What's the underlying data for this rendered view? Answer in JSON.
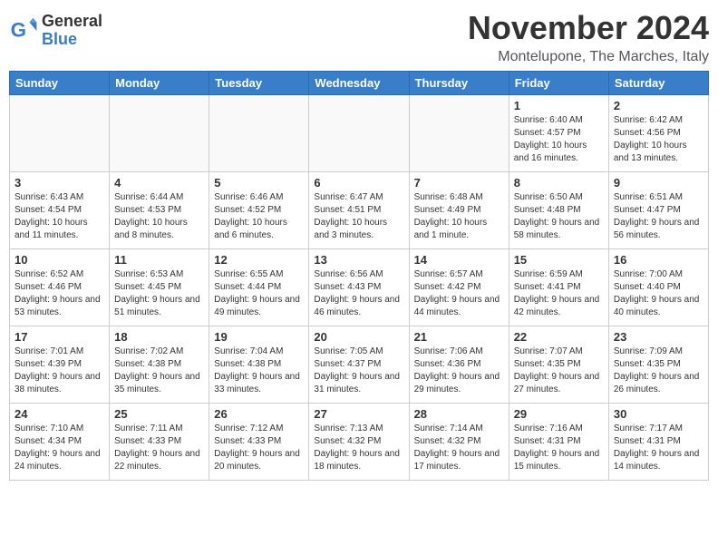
{
  "logo": {
    "general": "General",
    "blue": "Blue"
  },
  "title": "November 2024",
  "location": "Montelupone, The Marches, Italy",
  "days_of_week": [
    "Sunday",
    "Monday",
    "Tuesday",
    "Wednesday",
    "Thursday",
    "Friday",
    "Saturday"
  ],
  "weeks": [
    [
      {
        "day": "",
        "info": ""
      },
      {
        "day": "",
        "info": ""
      },
      {
        "day": "",
        "info": ""
      },
      {
        "day": "",
        "info": ""
      },
      {
        "day": "",
        "info": ""
      },
      {
        "day": "1",
        "info": "Sunrise: 6:40 AM\nSunset: 4:57 PM\nDaylight: 10 hours and 16 minutes."
      },
      {
        "day": "2",
        "info": "Sunrise: 6:42 AM\nSunset: 4:56 PM\nDaylight: 10 hours and 13 minutes."
      }
    ],
    [
      {
        "day": "3",
        "info": "Sunrise: 6:43 AM\nSunset: 4:54 PM\nDaylight: 10 hours and 11 minutes."
      },
      {
        "day": "4",
        "info": "Sunrise: 6:44 AM\nSunset: 4:53 PM\nDaylight: 10 hours and 8 minutes."
      },
      {
        "day": "5",
        "info": "Sunrise: 6:46 AM\nSunset: 4:52 PM\nDaylight: 10 hours and 6 minutes."
      },
      {
        "day": "6",
        "info": "Sunrise: 6:47 AM\nSunset: 4:51 PM\nDaylight: 10 hours and 3 minutes."
      },
      {
        "day": "7",
        "info": "Sunrise: 6:48 AM\nSunset: 4:49 PM\nDaylight: 10 hours and 1 minute."
      },
      {
        "day": "8",
        "info": "Sunrise: 6:50 AM\nSunset: 4:48 PM\nDaylight: 9 hours and 58 minutes."
      },
      {
        "day": "9",
        "info": "Sunrise: 6:51 AM\nSunset: 4:47 PM\nDaylight: 9 hours and 56 minutes."
      }
    ],
    [
      {
        "day": "10",
        "info": "Sunrise: 6:52 AM\nSunset: 4:46 PM\nDaylight: 9 hours and 53 minutes."
      },
      {
        "day": "11",
        "info": "Sunrise: 6:53 AM\nSunset: 4:45 PM\nDaylight: 9 hours and 51 minutes."
      },
      {
        "day": "12",
        "info": "Sunrise: 6:55 AM\nSunset: 4:44 PM\nDaylight: 9 hours and 49 minutes."
      },
      {
        "day": "13",
        "info": "Sunrise: 6:56 AM\nSunset: 4:43 PM\nDaylight: 9 hours and 46 minutes."
      },
      {
        "day": "14",
        "info": "Sunrise: 6:57 AM\nSunset: 4:42 PM\nDaylight: 9 hours and 44 minutes."
      },
      {
        "day": "15",
        "info": "Sunrise: 6:59 AM\nSunset: 4:41 PM\nDaylight: 9 hours and 42 minutes."
      },
      {
        "day": "16",
        "info": "Sunrise: 7:00 AM\nSunset: 4:40 PM\nDaylight: 9 hours and 40 minutes."
      }
    ],
    [
      {
        "day": "17",
        "info": "Sunrise: 7:01 AM\nSunset: 4:39 PM\nDaylight: 9 hours and 38 minutes."
      },
      {
        "day": "18",
        "info": "Sunrise: 7:02 AM\nSunset: 4:38 PM\nDaylight: 9 hours and 35 minutes."
      },
      {
        "day": "19",
        "info": "Sunrise: 7:04 AM\nSunset: 4:38 PM\nDaylight: 9 hours and 33 minutes."
      },
      {
        "day": "20",
        "info": "Sunrise: 7:05 AM\nSunset: 4:37 PM\nDaylight: 9 hours and 31 minutes."
      },
      {
        "day": "21",
        "info": "Sunrise: 7:06 AM\nSunset: 4:36 PM\nDaylight: 9 hours and 29 minutes."
      },
      {
        "day": "22",
        "info": "Sunrise: 7:07 AM\nSunset: 4:35 PM\nDaylight: 9 hours and 27 minutes."
      },
      {
        "day": "23",
        "info": "Sunrise: 7:09 AM\nSunset: 4:35 PM\nDaylight: 9 hours and 26 minutes."
      }
    ],
    [
      {
        "day": "24",
        "info": "Sunrise: 7:10 AM\nSunset: 4:34 PM\nDaylight: 9 hours and 24 minutes."
      },
      {
        "day": "25",
        "info": "Sunrise: 7:11 AM\nSunset: 4:33 PM\nDaylight: 9 hours and 22 minutes."
      },
      {
        "day": "26",
        "info": "Sunrise: 7:12 AM\nSunset: 4:33 PM\nDaylight: 9 hours and 20 minutes."
      },
      {
        "day": "27",
        "info": "Sunrise: 7:13 AM\nSunset: 4:32 PM\nDaylight: 9 hours and 18 minutes."
      },
      {
        "day": "28",
        "info": "Sunrise: 7:14 AM\nSunset: 4:32 PM\nDaylight: 9 hours and 17 minutes."
      },
      {
        "day": "29",
        "info": "Sunrise: 7:16 AM\nSunset: 4:31 PM\nDaylight: 9 hours and 15 minutes."
      },
      {
        "day": "30",
        "info": "Sunrise: 7:17 AM\nSunset: 4:31 PM\nDaylight: 9 hours and 14 minutes."
      }
    ]
  ]
}
